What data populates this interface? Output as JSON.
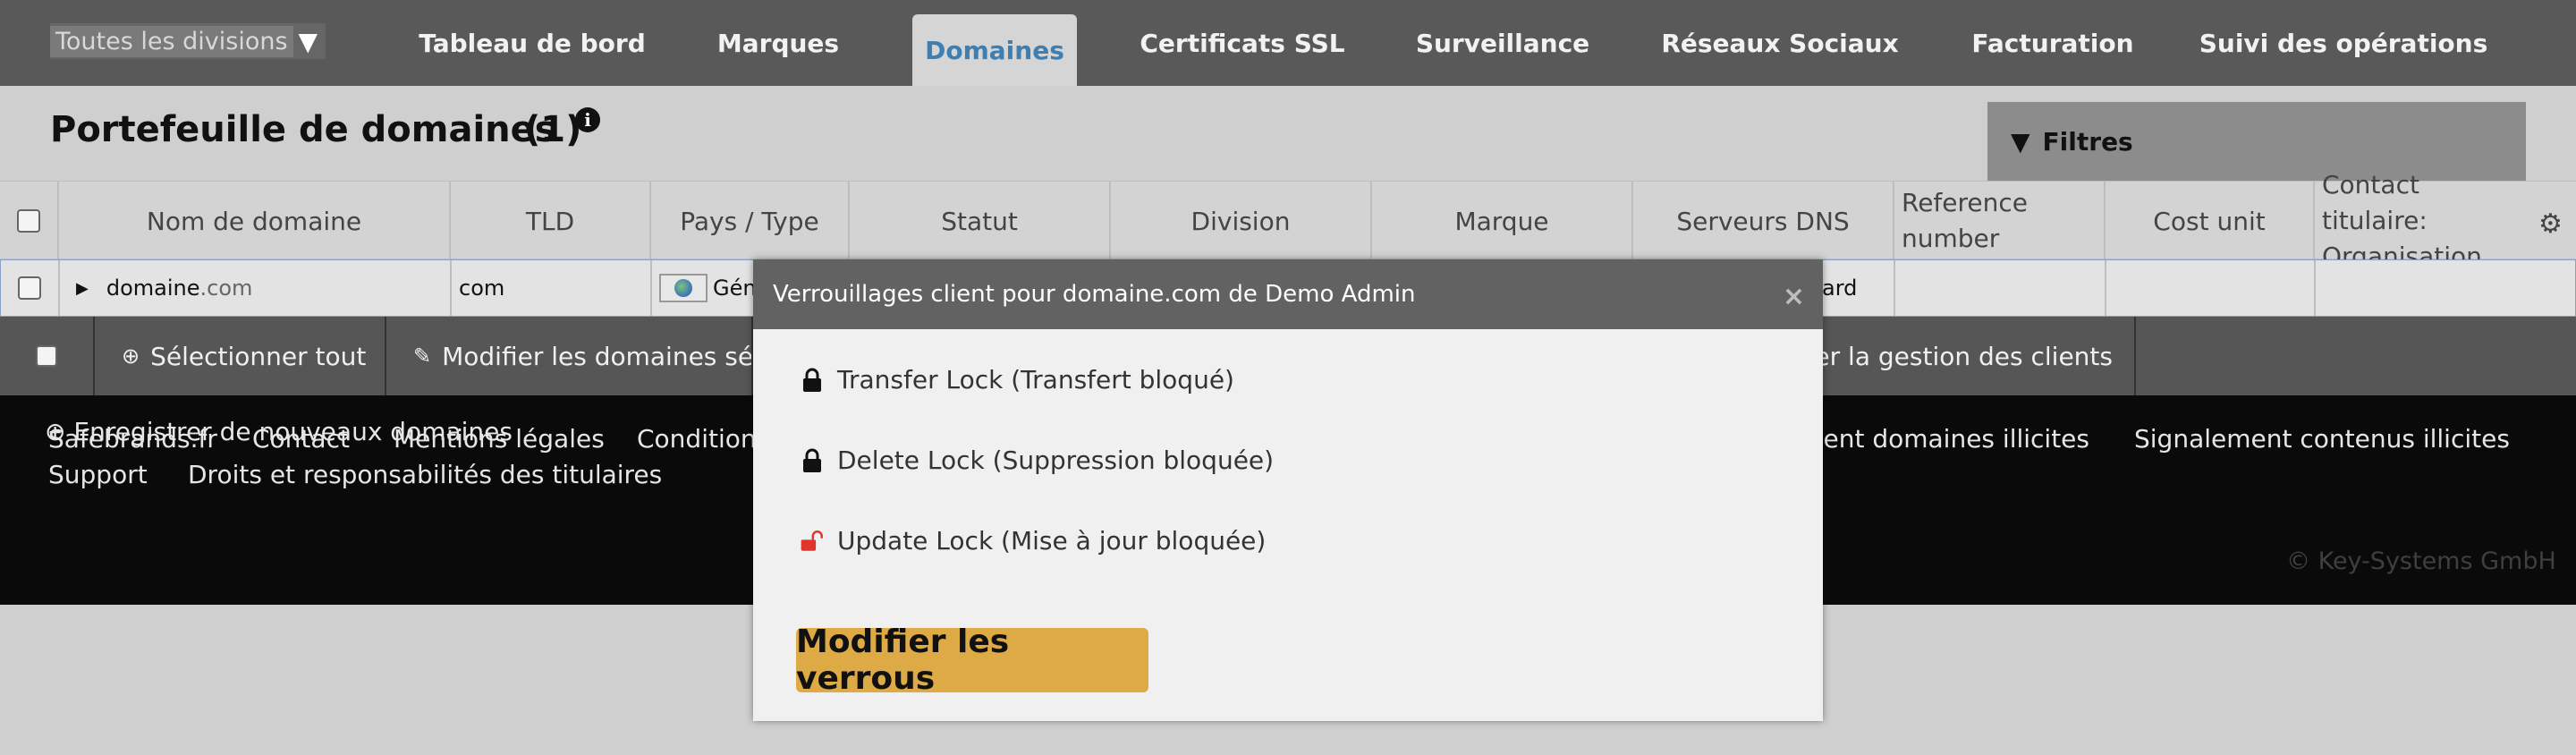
{
  "nav": {
    "division_select": "Toutes les divisions",
    "tabs": [
      {
        "label": "Tableau de bord"
      },
      {
        "label": "Marques"
      },
      {
        "label": "Domaines"
      },
      {
        "label": "Certificats SSL"
      },
      {
        "label": "Surveillance"
      },
      {
        "label": "Réseaux Sociaux"
      },
      {
        "label": "Facturation"
      },
      {
        "label": "Suivi des opérations"
      }
    ],
    "active_tab": "Domaines"
  },
  "page": {
    "title": "Portefeuille de domaines",
    "count": "(1)",
    "filters_label": "Filtres"
  },
  "table": {
    "columns": [
      "Nom de domaine",
      "TLD",
      "Pays / Type",
      "Statut",
      "Division",
      "Marque",
      "Serveurs DNS",
      "Reference number",
      "Cost unit",
      "Contact titulaire: Organisation"
    ],
    "row": {
      "domain_name": "domaine",
      "domain_suffix": ".com",
      "tld": "com",
      "type_partial": "Gén",
      "dns_partial": "ard"
    }
  },
  "actions": {
    "select_all": "Sélectionner tout",
    "modify_domains": "Modifier les domaines sélectionnés",
    "client_management": "Modifier la gestion des clients",
    "register_new": "Enregistrer de nouveaux domaines"
  },
  "footer": {
    "links_row1": [
      "Safebrands.fr",
      "Contact",
      "Mentions légales",
      "Conditions",
      "Signalement domaines illicites",
      "Signalement contenus illicites"
    ],
    "links_row2": [
      "Support",
      "Droits et responsabilités des titulaires"
    ],
    "copyright": "© Key-Systems GmbH"
  },
  "modal": {
    "title": "Verrouillages client pour domaine.com de Demo Admin",
    "locks": [
      {
        "label": "Transfer Lock (Transfert bloqué)",
        "state": "locked",
        "icon": "lock-closed-icon"
      },
      {
        "label": "Delete Lock (Suppression bloquée)",
        "state": "locked",
        "icon": "lock-closed-icon"
      },
      {
        "label": "Update Lock (Mise à jour bloquée)",
        "state": "unlocked",
        "icon": "lock-open-icon"
      }
    ],
    "button_label": "Modifier les verrous"
  },
  "colors": {
    "nav_bg": "#595959",
    "active_tab_text": "#3d7fb2",
    "button_bg": "#deaa45",
    "unlocked_icon": "#e0352b"
  }
}
